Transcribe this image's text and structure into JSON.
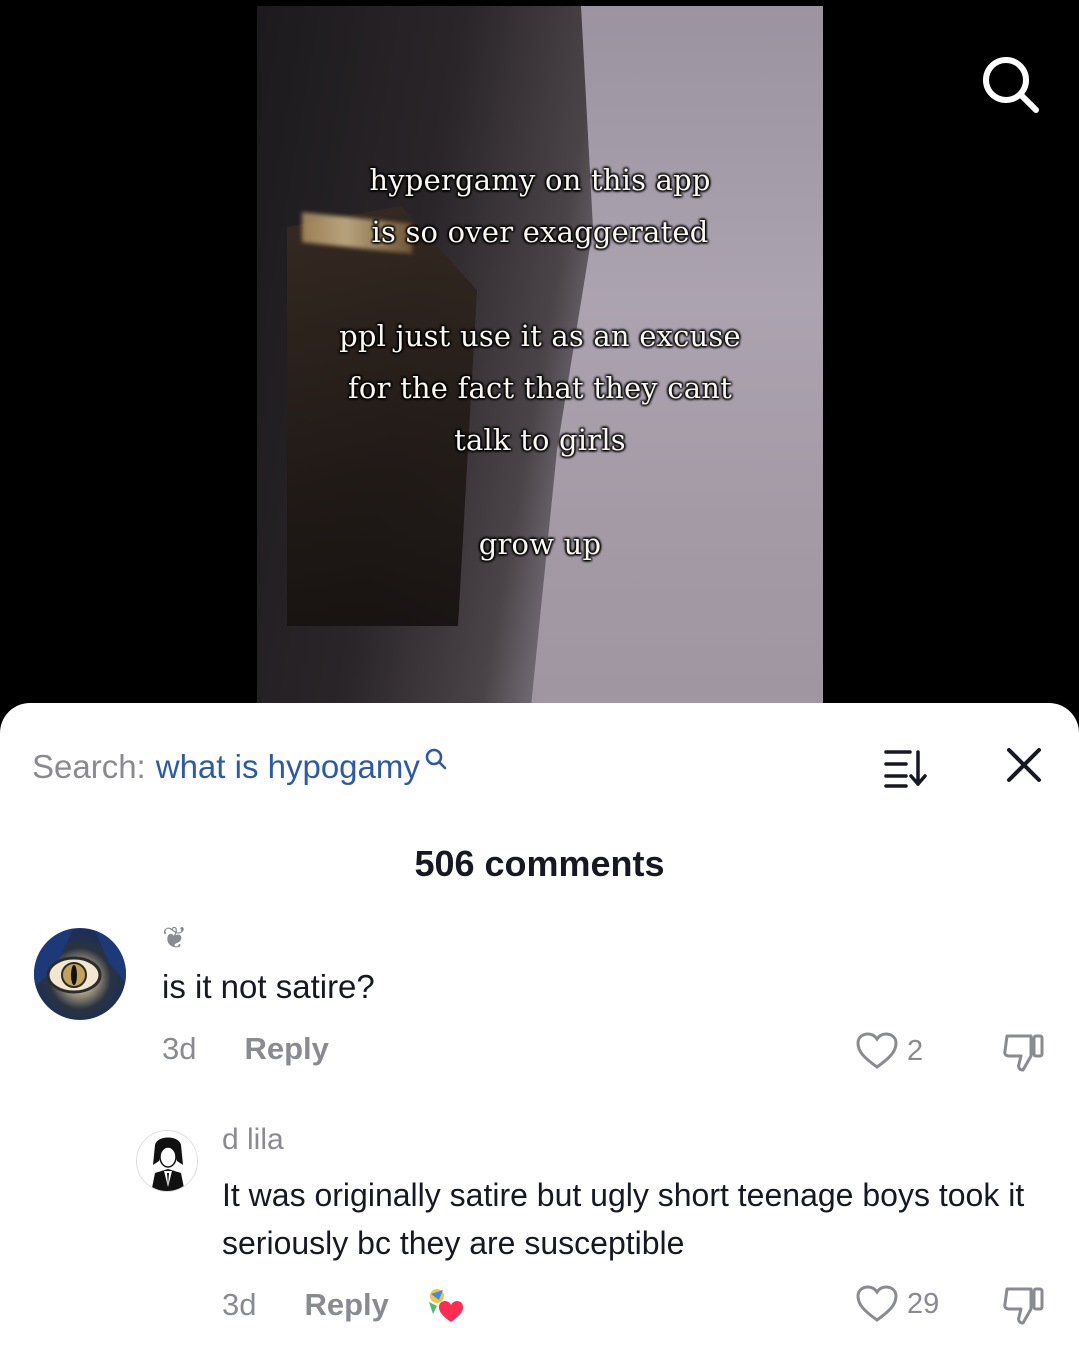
{
  "video": {
    "overlay_line1": "hypergamy on this app",
    "overlay_line2": "is so over exaggerated",
    "overlay_line3": "ppl just use it as an excuse",
    "overlay_line4": "for the fact that they cant",
    "overlay_line5": "talk to girls",
    "overlay_line6": "grow up",
    "search_icon": "search-icon"
  },
  "comments_panel": {
    "search_label": "Search:",
    "search_query": "what is hypogamy",
    "sort_icon": "sort-icon",
    "close_icon": "close-icon",
    "count_label": "506 comments"
  },
  "comments": [
    {
      "username": "❦",
      "text": "is it not satire?",
      "time": "3d",
      "reply_label": "Reply",
      "likes": "2"
    },
    {
      "username": "d lila",
      "text": "It was originally satire but ugly short teenage boys took it seriously bc they are susceptible",
      "time": "3d",
      "reply_label": "Reply",
      "likes": "29"
    }
  ]
}
